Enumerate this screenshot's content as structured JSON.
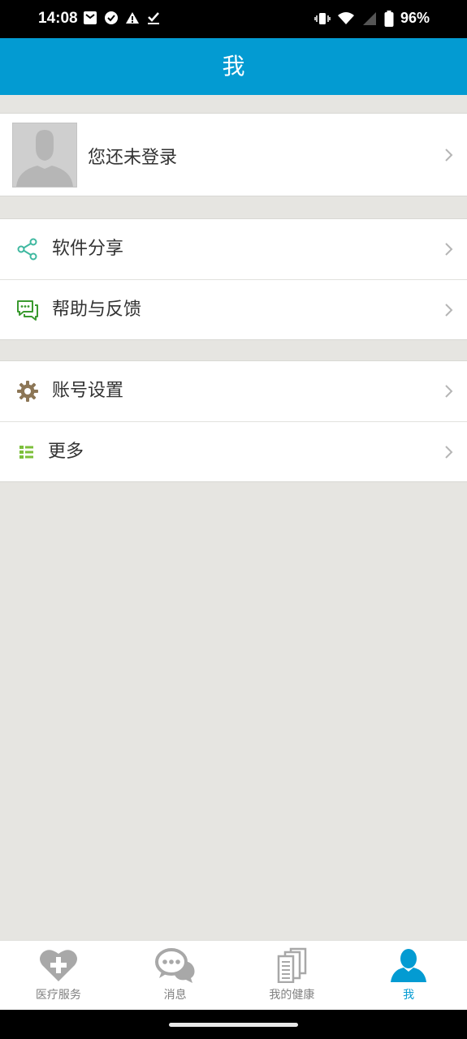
{
  "status_bar": {
    "time": "14:08",
    "battery_percent": "96%",
    "icons": [
      "mail-icon",
      "check-circle-icon",
      "alert-icon",
      "check-icon",
      "vibrate-icon",
      "wifi-icon",
      "signal-icon",
      "battery-icon"
    ]
  },
  "header": {
    "title": "我",
    "color": "#039bd2"
  },
  "profile": {
    "name": "您还未登录",
    "avatar_icon": "avatar-placeholder-icon"
  },
  "menu_groups": [
    {
      "items": [
        {
          "label": "软件分享",
          "icon": "share-icon",
          "icon_color": "#3fb8a0"
        },
        {
          "label": "帮助与反馈",
          "icon": "feedback-icon",
          "icon_color": "#3a9a2f"
        }
      ]
    },
    {
      "items": [
        {
          "label": "账号设置",
          "icon": "gear-icon",
          "icon_color": "#8c7656"
        },
        {
          "label": "更多",
          "icon": "list-icon",
          "icon_color": "#7cbf3a"
        }
      ]
    }
  ],
  "bottom_nav": {
    "tabs": [
      {
        "label": "医疗服务",
        "icon": "medical-heart-icon",
        "active": false
      },
      {
        "label": "消息",
        "icon": "message-bubbles-icon",
        "active": false
      },
      {
        "label": "我的健康",
        "icon": "documents-icon",
        "active": false
      },
      {
        "label": "我",
        "icon": "person-icon",
        "active": true
      }
    ],
    "active_color": "#039bd2",
    "inactive_color": "#808080"
  }
}
